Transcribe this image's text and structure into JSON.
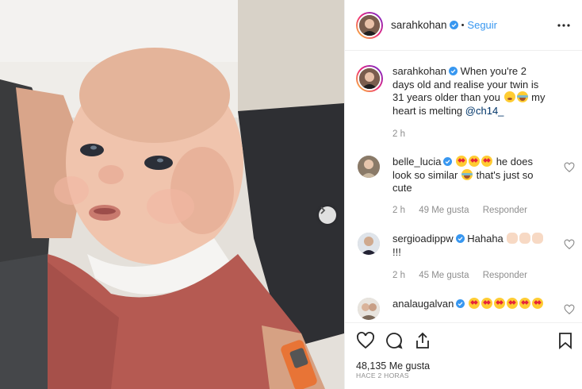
{
  "post": {
    "author": "sarahkohan",
    "follow_label": "Seguir",
    "separator": "•",
    "more_icon": "more-dots-icon",
    "caption": {
      "username": "sarahkohan",
      "text_part1": "When you're 2 days old and realise your twin is 31 years older than you",
      "text_part2": "my heart is melting",
      "mention": "@ch14_",
      "time": "2 h"
    },
    "likes": "48,135 Me gusta",
    "posted": "HACE 2 HORAS"
  },
  "comments": [
    {
      "username": "belle_lucia",
      "text_part1": "he does look so similar",
      "text_part2": "that's just so cute",
      "time": "2 h",
      "likes": "49 Me gusta",
      "reply": "Responder"
    },
    {
      "username": "sergioadippw",
      "text_part1": "Hahaha",
      "text_part2": "!!!",
      "time": "2 h",
      "likes": "45 Me gusta",
      "reply": "Responder"
    },
    {
      "username": "analaugalvan",
      "text_part1": "",
      "text_part2": ""
    }
  ],
  "colors": {
    "accent": "#3897f0",
    "verified": "#3897f0",
    "secondary_text": "#8e8e8e",
    "mention": "#003569"
  },
  "icons": [
    "heart-icon",
    "comment-icon",
    "share-icon",
    "bookmark-icon",
    "chevron-right-icon",
    "verified-badge-icon"
  ]
}
